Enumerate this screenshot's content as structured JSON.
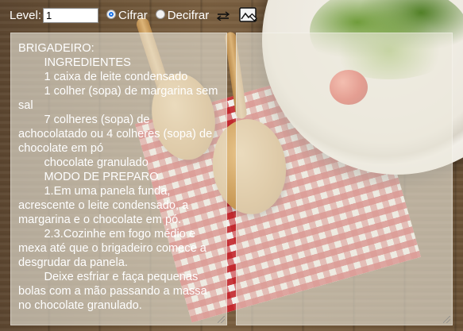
{
  "controls": {
    "level_label": "Level:",
    "level_value": "1",
    "cifrar_label": "Cifrar",
    "decifrar_label": "Decifrar",
    "selected_mode": "Cifrar"
  },
  "icons": {
    "swap": "swap-arrows-icon",
    "image": "image-edit-icon"
  },
  "colors": {
    "radio_accent": "#1a73e8",
    "text": "#ffffff",
    "panel_bg": "rgba(235,232,220,0.62)"
  },
  "input_panel": {
    "text": "BRIGADEIRO:\n\tINGREDIENTES\n\t1 caixa de leite condensado\n\t1 colher (sopa) de margarina sem sal\n\t7 colheres (sopa) de achocolatado ou 4 colheres (sopa) de chocolate em pó\n\tchocolate granulado\n\tMODO DE PREPARO\n\t1.Em uma panela funda, acrescente o leite condensado, a margarina e o chocolate em pó.\n\t2.3.Cozinhe em fogo médio e mexa até que o brigadeiro comece a desgrudar da panela.\n\tDeixe esfriar e faça pequenas bolas com a mão passando a massa no chocolate granulado."
  },
  "output_panel": {
    "text": ""
  }
}
